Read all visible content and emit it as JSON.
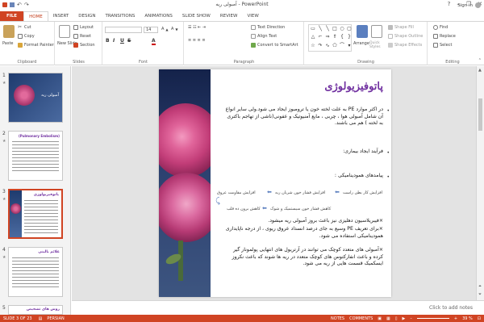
{
  "window": {
    "title": "آمبولی ریه - PowerPoint",
    "min": "–",
    "restore": "❐",
    "close": "✕"
  },
  "tabs": [
    {
      "label": "FILE"
    },
    {
      "label": "HOME"
    },
    {
      "label": "INSERT"
    },
    {
      "label": "DESIGN"
    },
    {
      "label": "TRANSITIONS"
    },
    {
      "label": "ANIMATIONS"
    },
    {
      "label": "SLIDE SHOW"
    },
    {
      "label": "REVIEW"
    },
    {
      "label": "VIEW"
    }
  ],
  "signin": "Sign in",
  "ribbon": {
    "clipboard": {
      "label": "Clipboard",
      "paste": "Paste",
      "cut": "Cut",
      "copy": "Copy",
      "format_painter": "Format Painter"
    },
    "slides": {
      "label": "Slides",
      "new_slide": "New Slide",
      "layout": "Layout",
      "reset": "Reset",
      "section": "Section"
    },
    "font": {
      "label": "Font",
      "font_name": "",
      "font_size": "14",
      "bold": "B",
      "italic": "I",
      "underline": "U",
      "strike": "S"
    },
    "paragraph": {
      "label": "Paragraph",
      "text_direction": "Text Direction",
      "align_text": "Align Text",
      "convert_smartart": "Convert to SmartArt"
    },
    "drawing": {
      "label": "Drawing",
      "arrange": "Arrange",
      "quick_styles": "Quick Styles",
      "shape_fill": "Shape Fill",
      "shape_outline": "Shape Outline",
      "shape_effects": "Shape Effects"
    },
    "editing": {
      "label": "Editing",
      "find": "Find",
      "replace": "Replace",
      "select": "Select"
    }
  },
  "thumbnails": [
    {
      "num": "1",
      "title": "آمبولی ریه"
    },
    {
      "num": "2",
      "title": "(Pulmonary Embolism)"
    },
    {
      "num": "3",
      "title": "پاتوفیزیولوژی"
    },
    {
      "num": "4",
      "title": "علائم بالینی"
    },
    {
      "num": "5",
      "title": "روش های تشخیص"
    }
  ],
  "slide": {
    "title": "پاتوفیزیولوژی",
    "p1": "در اکثر موارد PE به علت لخته خون یا ترومبوز ایجاد می شود.ولی سایر انواع آن شامل آمبولی هوا ، چربی ، مایع آمنیوتیک و عفونی(ناشی از تهاجم باکتری به لخته ) هم می باشند.",
    "p2": "فرآیند ایجاد بیماری:",
    "p3": "پیامدهای همودینامیکی :",
    "flow1": "افزایش مقاومت عروق",
    "flow2": "افزایش فشار خون شریان ریه",
    "flow3": "افزایش کار بطن راست",
    "flow4": "کاهش برون ده قلب",
    "flow5": "کاهش فشار خون سیستمیک و شوک",
    "p4": "×فیبریلاسیون دهلیزی نیز باعث بروز آمبولی ریه میشود.",
    "p5": "×برای تعریف PE وسیع به جای درصد انسداد عروق ریوی ، از درجه ناپایداری همودینامیکی استفاده می شود.",
    "p6": "×آمبولی های متعدد کوچک می توانند در آرتریول های انتهایی پولمونار گیر کرده و باعث انفارکتوس های کوچک متعدد در ریه ها شوند که باعث نکروز ایسکمیک قسمت هایی از ریه می شود."
  },
  "notes": "Click to add notes",
  "status": {
    "slide": "SLIDE 3 OF 23",
    "lang": "PERSIAN",
    "notes": "NOTES",
    "comments": "COMMENTS",
    "zoom": "39 %"
  },
  "colors": {
    "accent": "#d04423",
    "title": "#7030a0"
  }
}
